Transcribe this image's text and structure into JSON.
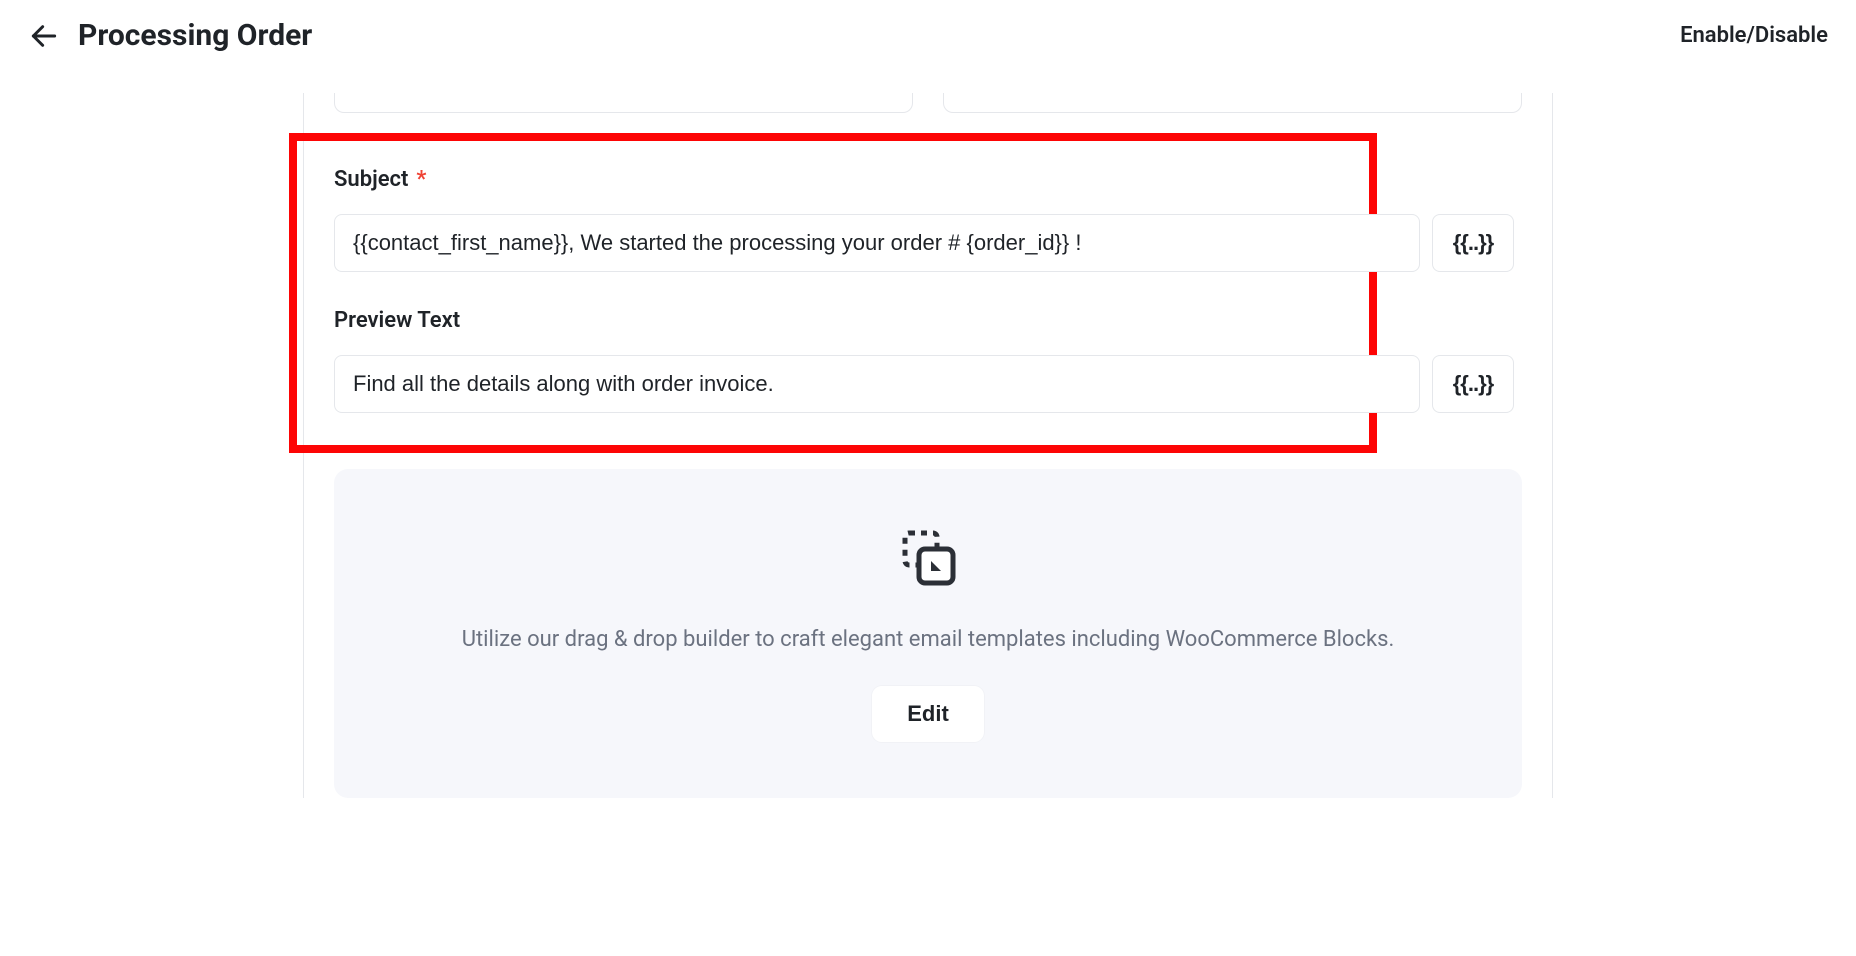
{
  "header": {
    "title": "Processing Order",
    "enable_disable": "Enable/Disable"
  },
  "form": {
    "subject_label": "Subject",
    "subject_value": "{{contact_first_name}}, We started the processing your order # {order_id}} !",
    "preview_label": "Preview Text",
    "preview_value": "Find all the details along with order invoice.",
    "merge_tag_label": "{{..}}"
  },
  "builder": {
    "description": "Utilize our drag & drop builder to craft elegant email templates including WooCommerce Blocks.",
    "edit_label": "Edit"
  }
}
